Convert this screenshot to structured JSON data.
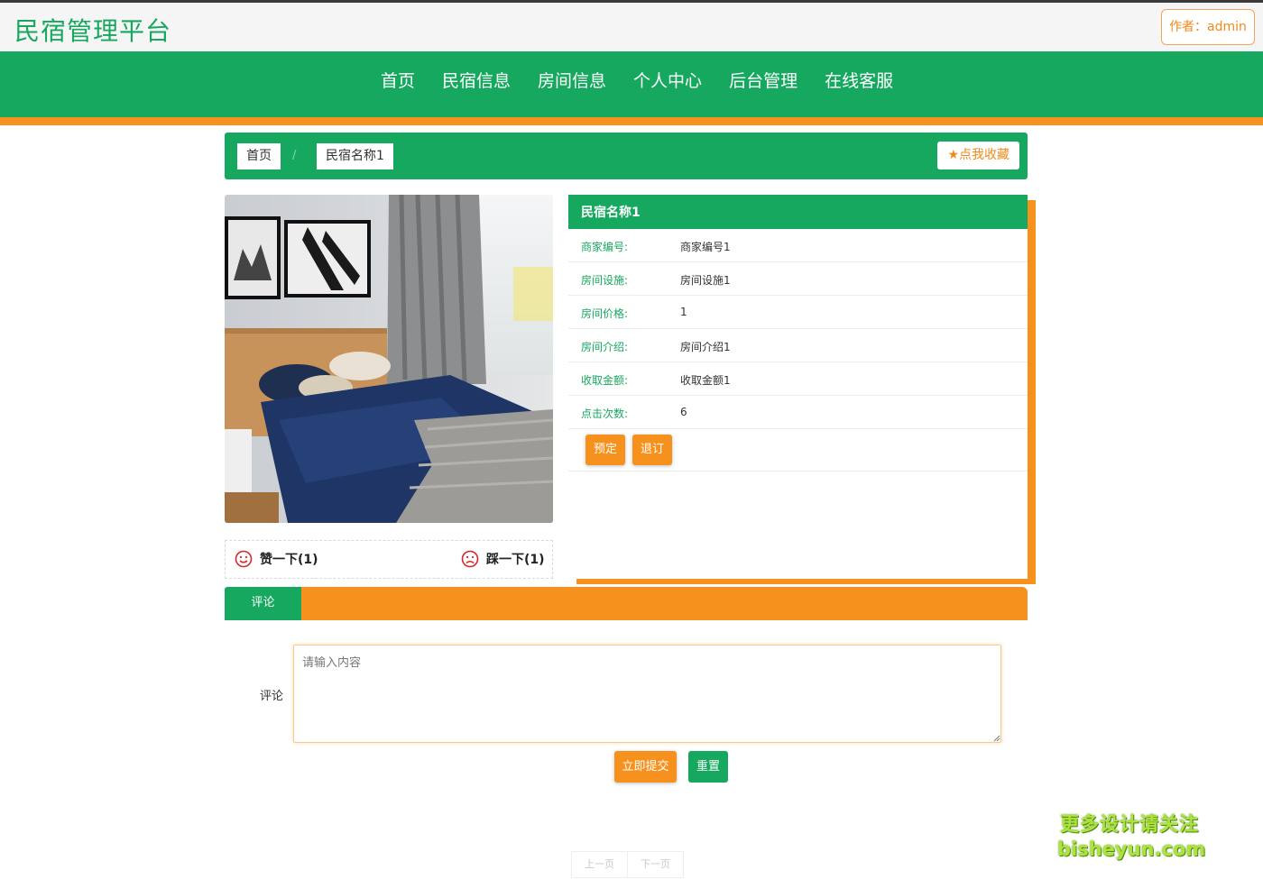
{
  "header": {
    "site_title": "民宿管理平台",
    "author_label": "作者：admin"
  },
  "nav": {
    "items": [
      {
        "label": "首页"
      },
      {
        "label": "民宿信息"
      },
      {
        "label": "房间信息"
      },
      {
        "label": "个人中心"
      },
      {
        "label": "后台管理"
      },
      {
        "label": "在线客服"
      }
    ]
  },
  "breadcrumb": {
    "home": "首页",
    "separator": "/",
    "current": "民宿名称1",
    "favorite_label": "点我收藏"
  },
  "vote": {
    "like_label": "赞一下(1)",
    "dislike_label": "踩一下(1)"
  },
  "info": {
    "title": "民宿名称1",
    "rows": [
      {
        "key": "商家编号:",
        "value": "商家编号1"
      },
      {
        "key": "房间设施:",
        "value": "房间设施1"
      },
      {
        "key": "房间价格:",
        "value": "1"
      },
      {
        "key": "房间介绍:",
        "value": "房间介绍1"
      },
      {
        "key": "收取金额:",
        "value": "收取金额1"
      },
      {
        "key": "点击次数:",
        "value": "6"
      }
    ],
    "book_label": "预定",
    "cancel_label": "退订"
  },
  "tabs": {
    "active": "评论"
  },
  "comment": {
    "label": "评论",
    "placeholder": "请输入内容",
    "submit_label": "立即提交",
    "reset_label": "重置"
  },
  "pager": {
    "prev": "上一页",
    "next": "下一页"
  },
  "watermark": {
    "line1": "更多设计请关注",
    "line2": "bisheyun.com"
  },
  "colors": {
    "primary_green": "#17a85f",
    "accent_orange": "#f7911d"
  }
}
